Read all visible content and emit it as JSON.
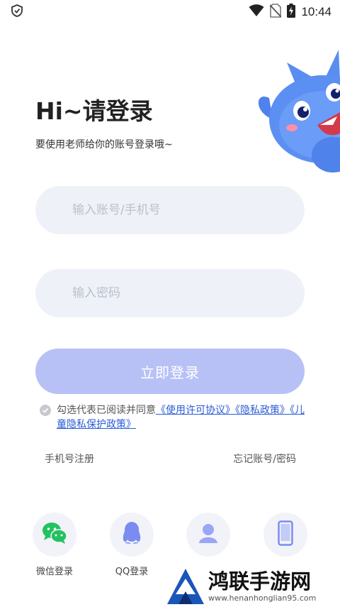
{
  "status_bar": {
    "time": "10:44"
  },
  "header": {
    "title": "Hi~请登录",
    "subtitle": "要使用老师给你的账号登录哦~"
  },
  "form": {
    "account_placeholder": "输入账号/手机号",
    "password_placeholder": "输入密码",
    "login_button": "立即登录"
  },
  "agreement": {
    "prefix": "勾选代表已阅读并同意",
    "link_terms": "《使用许可协议》",
    "link_privacy": "《隐私政策》",
    "link_child_privacy": "《儿童隐私保护政策》"
  },
  "links": {
    "phone_register": "手机号注册",
    "forgot": "忘记账号/密码"
  },
  "social": [
    {
      "label": "微信登录",
      "icon": "wechat-icon"
    },
    {
      "label": "QQ登录",
      "icon": "qq-icon"
    },
    {
      "label": "",
      "icon": "guest-icon"
    },
    {
      "label": "",
      "icon": "phone-icon"
    }
  ],
  "watermark": {
    "title": "鸿联手游网",
    "url": "www.henanhonglian95.com"
  },
  "colors": {
    "accent": "#b8c1f6",
    "input_bg": "#eef2f8",
    "link": "#2a5bd7",
    "wechat": "#23c160",
    "qq": "#7a8cf0"
  }
}
